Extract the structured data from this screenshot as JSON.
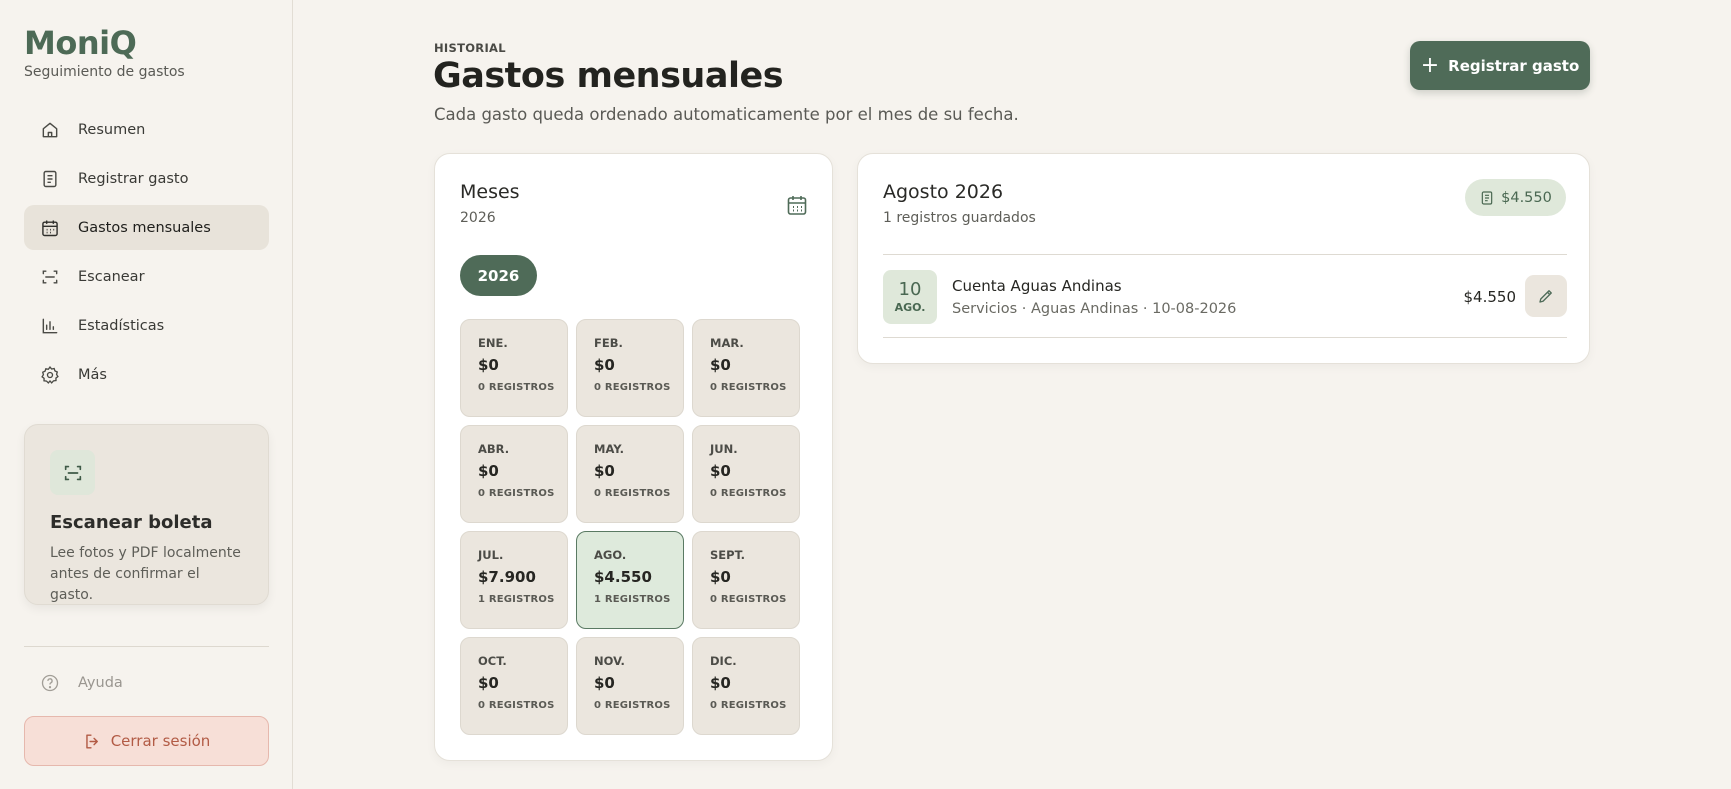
{
  "brand": {
    "name": "MoniQ",
    "tagline": "Seguimiento de gastos"
  },
  "nav": [
    {
      "label": "Resumen",
      "icon": "home-icon",
      "active": false
    },
    {
      "label": "Registrar gasto",
      "icon": "receipt-icon",
      "active": false
    },
    {
      "label": "Gastos mensuales",
      "icon": "calendar-icon",
      "active": true
    },
    {
      "label": "Escanear",
      "icon": "scan-icon",
      "active": false
    },
    {
      "label": "Estadísticas",
      "icon": "chart-icon",
      "active": false
    },
    {
      "label": "Más",
      "icon": "gear-icon",
      "active": false
    }
  ],
  "scan_card": {
    "title": "Escanear boleta",
    "description": "Lee fotos y PDF localmente antes de confirmar el gasto."
  },
  "help_label": "Ayuda",
  "logout_label": "Cerrar sesión",
  "header": {
    "eyebrow": "HISTORIAL",
    "title": "Gastos mensuales",
    "subtitle": "Cada gasto queda ordenado automaticamente por el mes de su fecha.",
    "primary_button": "Registrar gasto"
  },
  "months_panel": {
    "title": "Meses",
    "year": "2026",
    "year_pill": "2026",
    "months": [
      {
        "name": "ENE.",
        "amount": "$0",
        "count": "0 REGISTROS",
        "active": false
      },
      {
        "name": "FEB.",
        "amount": "$0",
        "count": "0 REGISTROS",
        "active": false
      },
      {
        "name": "MAR.",
        "amount": "$0",
        "count": "0 REGISTROS",
        "active": false
      },
      {
        "name": "ABR.",
        "amount": "$0",
        "count": "0 REGISTROS",
        "active": false
      },
      {
        "name": "MAY.",
        "amount": "$0",
        "count": "0 REGISTROS",
        "active": false
      },
      {
        "name": "JUN.",
        "amount": "$0",
        "count": "0 REGISTROS",
        "active": false
      },
      {
        "name": "JUL.",
        "amount": "$7.900",
        "count": "1 REGISTROS",
        "active": false
      },
      {
        "name": "AGO.",
        "amount": "$4.550",
        "count": "1 REGISTROS",
        "active": true
      },
      {
        "name": "SEPT.",
        "amount": "$0",
        "count": "0 REGISTROS",
        "active": false
      },
      {
        "name": "OCT.",
        "amount": "$0",
        "count": "0 REGISTROS",
        "active": false
      },
      {
        "name": "NOV.",
        "amount": "$0",
        "count": "0 REGISTROS",
        "active": false
      },
      {
        "name": "DIC.",
        "amount": "$0",
        "count": "0 REGISTROS",
        "active": false
      }
    ]
  },
  "detail": {
    "title": "Agosto 2026",
    "subtitle": "1 registros guardados",
    "total": "$4.550",
    "entries": [
      {
        "day": "10",
        "month": "AGO.",
        "name": "Cuenta Aguas Andinas",
        "meta": "Servicios · Aguas Andinas · 10-08-2026",
        "amount": "$4.550"
      }
    ]
  },
  "colors": {
    "accent": "#4f6b58",
    "background": "#f6f3ee",
    "tile": "#ebe6de",
    "active_tile": "#deeadc",
    "danger": "#b25b45"
  }
}
